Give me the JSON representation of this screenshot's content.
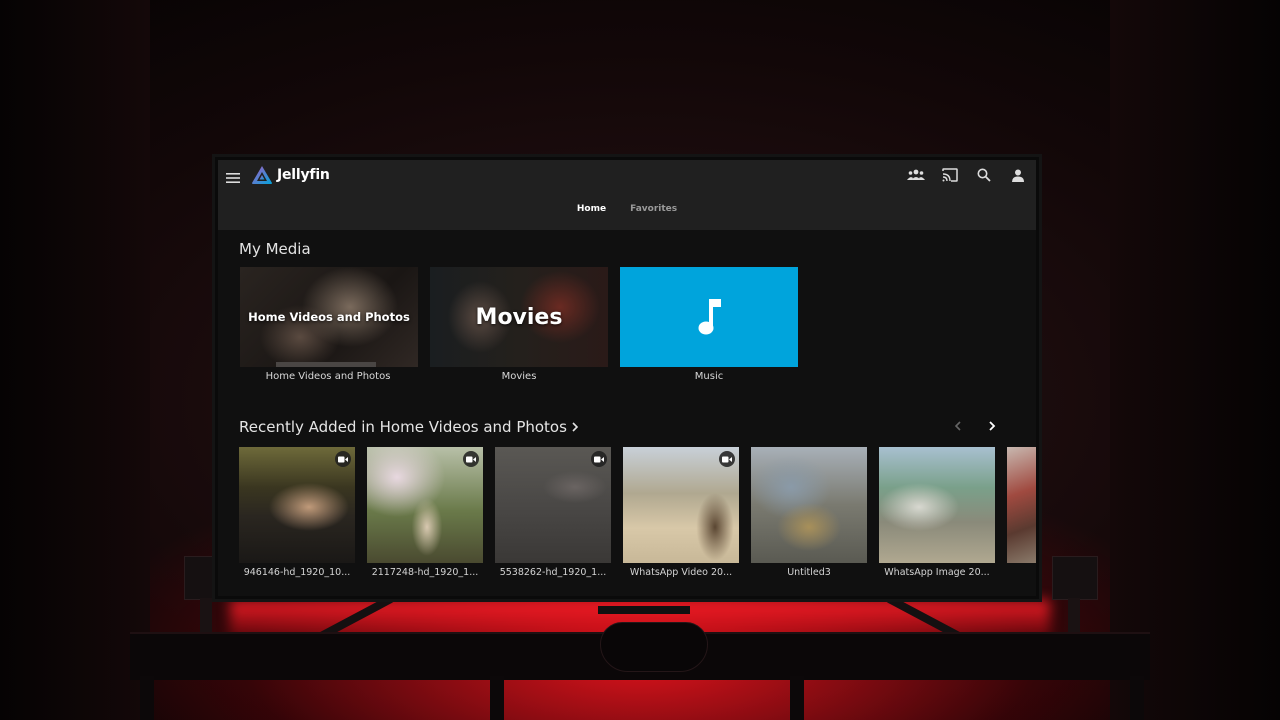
{
  "app": {
    "brand_name": "Jellyfin",
    "accent_color": "#aa5cc3",
    "accent_color_2": "#00a4dc"
  },
  "header": {
    "icons": [
      "menu-icon",
      "users-icon",
      "cast-icon",
      "search-icon",
      "user-icon"
    ]
  },
  "tabs": [
    {
      "label": "Home",
      "active": true
    },
    {
      "label": "Favorites",
      "active": false
    }
  ],
  "my_media": {
    "title": "My Media",
    "items": [
      {
        "label": "Home Videos and Photos",
        "overlay": "Home Videos and Photos"
      },
      {
        "label": "Movies",
        "overlay": "Movies"
      },
      {
        "label": "Music",
        "icon": "music-note-icon",
        "color": "#00a4dc"
      }
    ]
  },
  "recently_added": {
    "title": "Recently Added in Home Videos and Photos",
    "items": [
      {
        "label": "946146-hd_1920_10...",
        "badge": "video-camera-icon"
      },
      {
        "label": "2117248-hd_1920_1...",
        "badge": "video-camera-icon"
      },
      {
        "label": "5538262-hd_1920_1...",
        "badge": "video-camera-icon"
      },
      {
        "label": "WhatsApp Video 20...",
        "badge": "video-camera-icon"
      },
      {
        "label": "Untitled3"
      },
      {
        "label": "WhatsApp Image 20..."
      }
    ]
  }
}
